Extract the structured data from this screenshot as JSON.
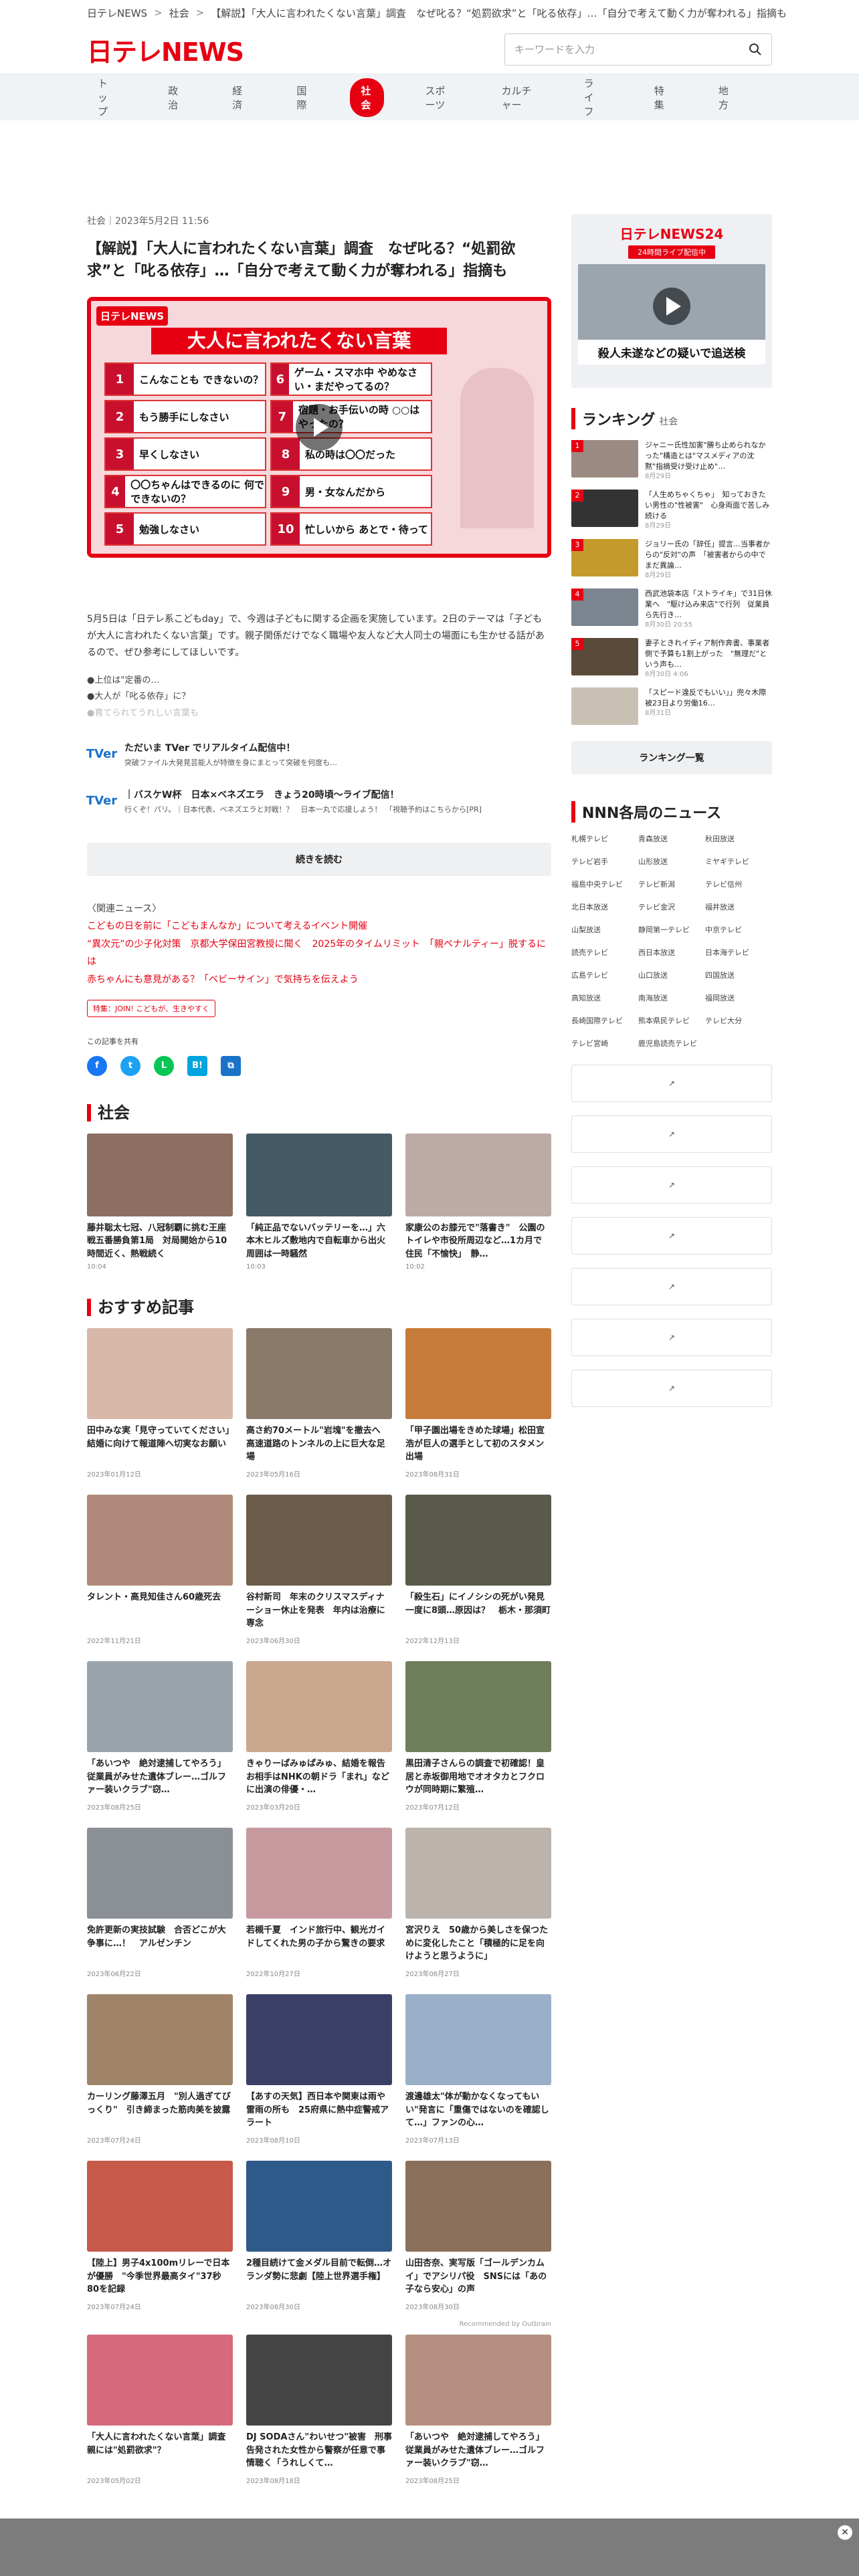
{
  "breadcrumb": {
    "site": "日テレNEWS",
    "category": "社会",
    "article": "【解説】「大人に言われたくない言葉」調査　なぜ叱る？“処罰欲求”と「叱る依存」…「自分で考えて動く力が奪われる」指摘も"
  },
  "logo": "日テレNEWS",
  "search": {
    "placeholder": "キーワードを入力"
  },
  "nav": [
    "トップ",
    "政治",
    "経済",
    "国際",
    "社会",
    "スポーツ",
    "カルチャー",
    "ライフ",
    "特集",
    "地方"
  ],
  "article": {
    "meta": "社会｜2023年5月2日 11:56",
    "title": "【解説】「大人に言われたくない言葉」調査　なぜ叱る？“処罰欲求”と「叱る依存」…「自分で考えて動く力が奪われる」指摘も",
    "video": {
      "header": "大人に言われたくない言葉",
      "items": [
        "こんなことも できないの？",
        "もう勝手にしなさい",
        "早くしなさい",
        "〇〇ちゃんはできるのに 何でできないの？",
        "勉強しなさい",
        "ゲーム・スマホ中 やめなさい・まだやってるの？",
        "宿題・お手伝いの時 ○○は やったの？",
        "私の時は〇〇だった",
        "男・女なんだから",
        "忙しいから あとで・待って"
      ]
    },
    "body": "5月5日は「日テレ系こどもday」で、今週は子どもに関する企画を実施しています。2日のテーマは「子どもが大人に言われたくない言葉」です。親子関係だけでなく職場や友人など大人同士の場面にも生かせる話があるので、ぜひ参考にしてほしいです。",
    "points": [
      "●上位は\"定番の…",
      "●大人が「叱る依存」に？",
      "●育てられてうれしい言葉も"
    ],
    "promos": [
      {
        "title": "ただいま TVer でリアルタイム配信中！",
        "sub": "突破ファイル大発見芸能人が特徴を身にまとって突破を何度も…"
      },
      {
        "title": "｜バスケW杯　日本×ベネズエラ　きょう20時頃〜ライブ配信！",
        "sub": "行くぞ！パリ。｜日本代表、ベネズエラと対戦！？　日本一丸で応援しよう！　「視聴予約はこちらから[PR]"
      }
    ],
    "more": "続きを読む",
    "related_label": "〈関連ニュース〉",
    "related": [
      "こどもの日を前に「こどもまんなか」について考えるイベント開催",
      "“異次元”の少子化対策　京都大学保田宮教授に聞く　2025年のタイムリミット　「親ペナルティー」脱するには",
      "赤ちゃんにも意見がある？「ベビーサイン」で気持ちを伝えよう"
    ],
    "tag": "特集：JOIN! こどもが、生きやすく",
    "share_label": "この記事を共有"
  },
  "social": {
    "heading": "社会",
    "cards": [
      {
        "title": "藤井聡太七冠、八冠制覇に挑む王座戦五番勝負第1局　対局開始から10時間近く、熱戦続く",
        "time": "10:04"
      },
      {
        "title": "「純正品でないバッテリーを…」六本木ヒルズ敷地内で自転車から出火　周囲は一時騒然",
        "time": "10:03"
      },
      {
        "title": "家康公のお膝元で\"落書き\"　公園のトイレや市役所周辺など…1カ月で　住民「不愉快」　静…",
        "time": "10:02"
      }
    ]
  },
  "recommend": {
    "heading": "おすすめ記事",
    "outbrain": "Recommended by Outbrain",
    "cards": [
      {
        "title": "田中みな実「見守っていてください」　結婚に向けて報道陣へ切実なお願い",
        "date": "2023年01月12日"
      },
      {
        "title": "高さ約70メートル\"岩塊\"を撤去へ　高速道路のトンネルの上に巨大な足場",
        "date": "2023年05月16日"
      },
      {
        "title": "「甲子園出場をきめた球場」松田宣浩が巨人の選手として初のスタメン出場",
        "date": "2023年08月31日"
      },
      {
        "title": "タレント・高見知佳さん60歳死去",
        "date": "2022年11月21日"
      },
      {
        "title": "谷村新司　年末のクリスマスディナーショー休止を発表　年内は治療に専念",
        "date": "2023年06月30日"
      },
      {
        "title": "「殺生石」にイノシシの死がい発見　一度に8頭…原因は？　栃木・那須町",
        "date": "2022年12月13日"
      },
      {
        "title": "「あいつや　絶対逮捕してやろう」従業員がみせた遺体ブレー…ゴルファー装いクラブ\"窃…",
        "date": "2023年08月25日"
      },
      {
        "title": "きゃりーぱみゅぱみゅ、結婚を報告　お相手はNHKの朝ドラ「まれ」などに出演の俳優・…",
        "date": "2023年03月20日"
      },
      {
        "title": "黒田清子さんらの調査で初確認！皇居と赤坂御用地でオオタカとフクロウが同時期に繁殖…",
        "date": "2023年07月12日"
      },
      {
        "title": "免許更新の実技試験　合否どこが大争事に…！　アルゼンチン",
        "date": "2023年06月22日"
      },
      {
        "title": "若槻千夏　インド旅行中、観光ガイドしてくれた男の子から驚きの要求",
        "date": "2022年10月27日"
      },
      {
        "title": "宮沢りえ　50歳から美しさを保つために変化したこと「積極的に足を向けようと思うように」",
        "date": "2023年08月27日"
      },
      {
        "title": "カーリング藤澤五月　\"別人過ぎてびっくり\"　引き締まった筋肉美を披露",
        "date": "2023年07月24日"
      },
      {
        "title": "【あすの天気】西日本や関東は雨や雷雨の所も　25府県に熱中症警戒アラート",
        "date": "2023年08月10日"
      },
      {
        "title": "渡邊雄太\"体が動かなくなってもいい\"発言に「重傷ではないのを確認して…」ファンの心…",
        "date": "2023年07月13日"
      },
      {
        "title": "【陸上】男子4x100mリレーで日本が優勝　\"今季世界最高タイ\"37秒80を記録",
        "date": "2023年07月24日"
      },
      {
        "title": "2種目続けて金メダル目前で転倒…オランダ勢に悲劇【陸上世界選手権】",
        "date": "2023年08月30日"
      },
      {
        "title": "山田杏奈、実写版「ゴールデンカムイ」でアシリパ役　SNSには「あの子なら安心」の声",
        "date": "2023年08月30日"
      },
      {
        "title": "「大人に言われたくない言葉」調査　親には\"処罰欲求\"？",
        "date": "2023年05月02日"
      },
      {
        "title": "DJ SODAさん\"わいせつ\"被害　刑事告発された女性から警察が任意で事情聴く「うれしくて…",
        "date": "2023年08月18日"
      },
      {
        "title": "「あいつや　絶対逮捕してやろう」従業員がみせた遺体ブレー…ゴルファー装いクラブ\"窃…",
        "date": "2023年08月25日"
      }
    ]
  },
  "sidebar": {
    "live": {
      "logo": "日テレNEWS24",
      "tag": "24時間ライブ配信中",
      "caption": "殺人未遂などの疑いで追送検"
    },
    "ranking": {
      "heading": "ランキング",
      "sub": "社会",
      "button": "ランキング一覧",
      "items": [
        {
          "title": "ジャニー氏性加害\"勝ち止められなかった\"構造とは\"マスメディアの沈黙\"指摘受け受け止め\"…",
          "date": "8月29日"
        },
        {
          "title": "「人生めちゃくちゃ」　知っておきたい男性の\"性被害\"　心身両面で苦しみ続ける",
          "date": "8月29日"
        },
        {
          "title": "ジョリー氏の「辞任」提言…当事者からの\"反対\"の声　「被害者からの中でまだ異論…",
          "date": "8月29日"
        },
        {
          "title": "西武池袋本店「ストライキ」で31日休業へ　\"駆け込み来店\"で行列　従業員ら先行き…",
          "date": "8月30日 20:55"
        },
        {
          "title": "妻子ときれイディア制作奔書、事業者側で予算も1割上がった　\"無理だ\"という声も…",
          "date": "8月30日 4:06"
        },
        {
          "title": "「スピード違反でもいい」」兜々木際被23日より労働16…",
          "date": "8月31日"
        }
      ]
    },
    "nnn": {
      "heading": "NNN各局のニュース",
      "stations": [
        "札幌テレビ",
        "青森放送",
        "秋田放送",
        "テレビ岩手",
        "山形放送",
        "ミヤギテレビ",
        "福島中央テレビ",
        "テレビ新潟",
        "テレビ信州",
        "北日本放送",
        "テレビ金沢",
        "福井放送",
        "山梨放送",
        "静岡第一テレビ",
        "中京テレビ",
        "読売テレビ",
        "西日本放送",
        "日本海テレビ",
        "広島テレビ",
        "山口放送",
        "四国放送",
        "高知放送",
        "南海放送",
        "福岡放送",
        "長崎国際テレビ",
        "熊本県民テレビ",
        "テレビ大分",
        "テレビ宮崎",
        "鹿児島読売テレビ"
      ]
    }
  }
}
